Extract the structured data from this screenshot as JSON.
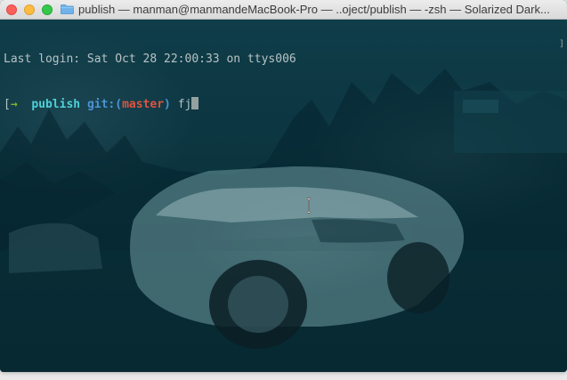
{
  "window": {
    "title": "publish — manman@manmandeMacBook-Pro — ..oject/publish — -zsh — Solarized Dark...",
    "controls": {
      "close": "close-icon",
      "minimize": "minimize-icon",
      "maximize": "maximize-icon"
    },
    "folder_icon": "folder-icon"
  },
  "terminal": {
    "last_login": "Last login: Sat Oct 28 22:00:33 on ttys006",
    "prompt": {
      "open_bracket": "[",
      "arrow": "→",
      "directory": "publish",
      "git_label": "git:(",
      "branch": "master",
      "git_close": ")",
      "command": "fj"
    },
    "scroll_marker": "]"
  },
  "colors": {
    "background": "#0b3540",
    "prompt_arrow": "#85b32a",
    "directory": "#4fd0d8",
    "git": "#4d93d6",
    "branch": "#e0523f",
    "text": "#b7c3c4"
  }
}
